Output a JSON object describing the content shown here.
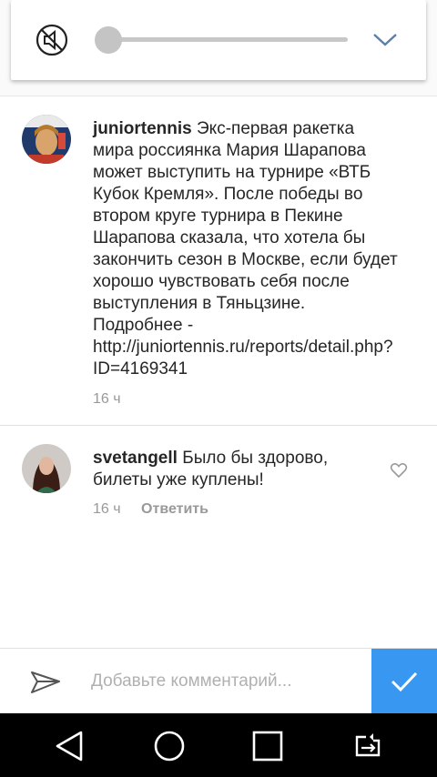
{
  "volume_panel": {
    "mute_icon": "volume-mute-icon",
    "level_percent": 0,
    "expand_icon": "chevron-down-icon"
  },
  "comments": [
    {
      "username": "juniortennis",
      "text": "Экс-первая ракетка мира россиянка Мария Шарапова может выступить на турнире «ВТБ Кубок Кремля». После победы во втором круге турнира в Пекине Шарапова сказала, что хотела бы закончить сезон в Москве, если будет хорошо чувствовать себя после выступления в Тяньцзине. Подробнее - http://juniortennis.ru/reports/detail.php?ID=4169341",
      "time": "16 ч"
    },
    {
      "username": "svetangell",
      "text": "Было бы здорово, билеты уже куплены!",
      "time": "16 ч",
      "reply_label": "Ответить",
      "like_icon": "heart-outline-icon"
    }
  ],
  "composer": {
    "placeholder": "Добавьте комментарий...",
    "value": "",
    "send_icon": "paper-plane-icon",
    "post_icon": "checkmark-icon",
    "accent_color": "#3897f0"
  },
  "system_nav": {
    "items": [
      "back-icon",
      "home-icon",
      "recents-icon",
      "screen-rotate-icon"
    ]
  }
}
